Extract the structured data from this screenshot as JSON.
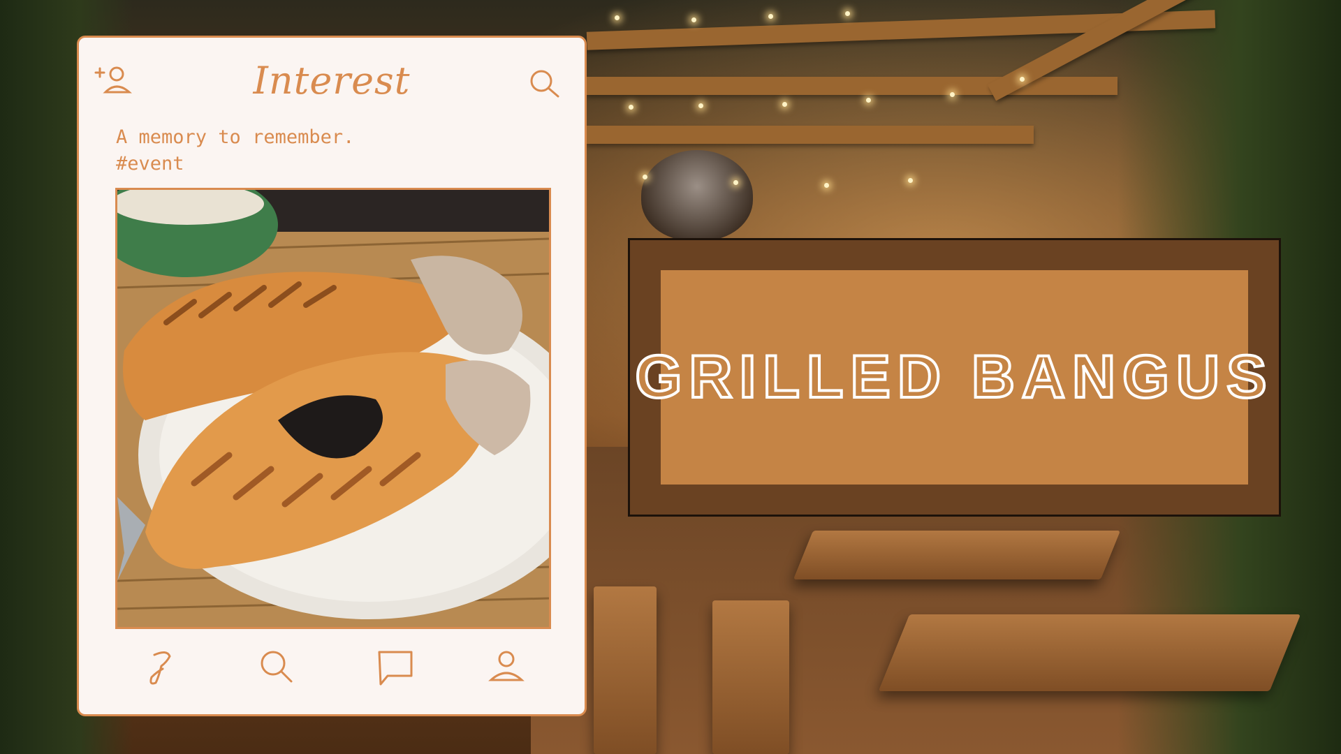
{
  "app": {
    "title": "Interest"
  },
  "header": {
    "add_user_icon": "add-user-icon",
    "search_icon": "search-icon"
  },
  "post": {
    "caption": "A memory to remember.",
    "hashtag": "#event",
    "image": "grilled-fish-photo"
  },
  "bottom_nav": {
    "items": [
      {
        "icon": "home-logo-icon"
      },
      {
        "icon": "search-icon"
      },
      {
        "icon": "message-icon"
      },
      {
        "icon": "profile-icon"
      }
    ]
  },
  "headline": {
    "text": "GRILLED BANGUS"
  },
  "colors": {
    "accent": "#d98b4f",
    "card_bg": "#fbf5f2",
    "panel_outer": "#6a4222",
    "panel_inner": "#c58445",
    "headline_stroke": "#ffffff"
  }
}
